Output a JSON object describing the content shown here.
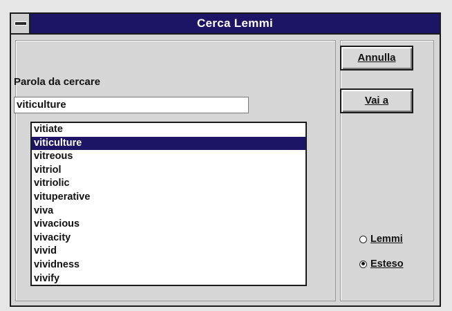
{
  "window": {
    "title": "Cerca Lemmi"
  },
  "search": {
    "label": "Parola da cercare",
    "value": "viticulture"
  },
  "list": {
    "items": [
      "vitiate",
      "viticulture",
      "vitreous",
      "vitriol",
      "vitriolic",
      "vituperative",
      "viva",
      "vivacious",
      "vivacity",
      "vivid",
      "vividness",
      "vivify"
    ],
    "selected": "viticulture"
  },
  "buttons": {
    "cancel": "Annulla",
    "goto": "Vai a"
  },
  "mode": {
    "options": [
      "Lemmi",
      "Esteso"
    ],
    "selected": "Esteso"
  },
  "colors": {
    "titlebar": "#1c1464",
    "selection": "#1c1464",
    "face": "#d6d6d6"
  }
}
